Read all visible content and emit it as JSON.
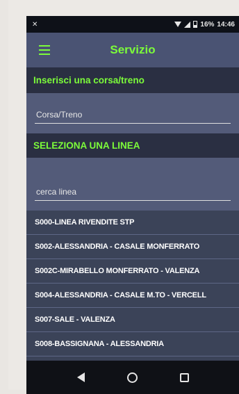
{
  "statusbar": {
    "left_icon": "notification-x-icon",
    "battery": "16%",
    "time": "14:46"
  },
  "appbar": {
    "title": "Servizio",
    "menu_icon": "hamburger-icon"
  },
  "train_section": {
    "header": "Inserisci una corsa/treno",
    "placeholder": "Corsa/Treno"
  },
  "line_section": {
    "header": "SELEZIONA UNA LINEA",
    "placeholder": "cerca linea"
  },
  "lines": [
    "S000-LINEA RIVENDITE STP",
    "S002-ALESSANDRIA - CASALE MONFERRATO",
    "S002C-MIRABELLO MONFERRATO - VALENZA",
    "S004-ALESSANDRIA - CASALE M.TO - VERCELL",
    "S007-SALE - VALENZA",
    "S008-BASSIGNANA - ALESSANDRIA"
  ],
  "colors": {
    "accent": "#7cfc3a",
    "appbar": "#4a5373",
    "section_header": "#2a2f42",
    "background": "#3b4358"
  }
}
